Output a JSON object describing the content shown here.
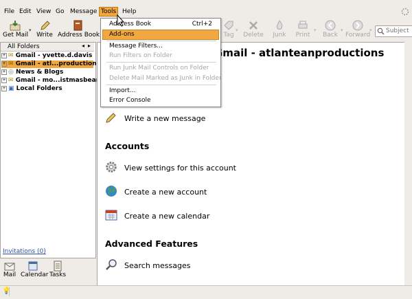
{
  "menubar": {
    "items": [
      {
        "label": "File"
      },
      {
        "label": "Edit"
      },
      {
        "label": "View"
      },
      {
        "label": "Go"
      },
      {
        "label": "Message"
      },
      {
        "label": "Tools"
      },
      {
        "label": "Help"
      }
    ]
  },
  "toolbar": {
    "get_mail": "Get Mail",
    "write": "Write",
    "address_book": "Address Book",
    "tag": "Tag",
    "delete": "Delete",
    "junk": "Junk",
    "print": "Print",
    "back": "Back",
    "forward": "Forward",
    "search_placeholder": "Subject"
  },
  "tools_menu": {
    "items": [
      {
        "label": "Address Book",
        "shortcut": "Ctrl+2",
        "enabled": true
      },
      {
        "label": "Add-ons",
        "enabled": true,
        "highlighted": true
      },
      {
        "label": "Message Filters...",
        "enabled": true
      },
      {
        "label": "Run Filters on Folder",
        "enabled": false
      },
      {
        "label": "Run Junk Mail Controls on Folder",
        "enabled": false
      },
      {
        "label": "Delete Mail Marked as Junk in Folder",
        "enabled": false
      },
      {
        "label": "Import...",
        "enabled": true
      },
      {
        "label": "Error Console",
        "enabled": true
      }
    ]
  },
  "folder_pane": {
    "header": "All Folders",
    "folders": [
      {
        "label": "Gmail - yvette.d.davis"
      },
      {
        "label": "Gmail - atl...productions",
        "selected": true
      },
      {
        "label": "News & Blogs"
      },
      {
        "label": "Gmail - mo...istmasbear"
      },
      {
        "label": "Local Folders"
      }
    ],
    "invitations": "Invitations (0)"
  },
  "bottom_pane": {
    "mail": "Mail",
    "calendar": "Calendar",
    "tasks": "Tasks"
  },
  "content": {
    "account_title": "Gmail - atlanteanproductions",
    "write_new": "Write a new message",
    "accounts_heading": "Accounts",
    "view_settings": "View settings for this account",
    "create_account": "Create a new account",
    "create_calendar": "Create a new calendar",
    "advanced_heading": "Advanced Features",
    "search_messages": "Search messages"
  },
  "colors": {
    "highlight": "#f1a840",
    "link": "#2a50a8",
    "chrome": "#efebe7"
  }
}
